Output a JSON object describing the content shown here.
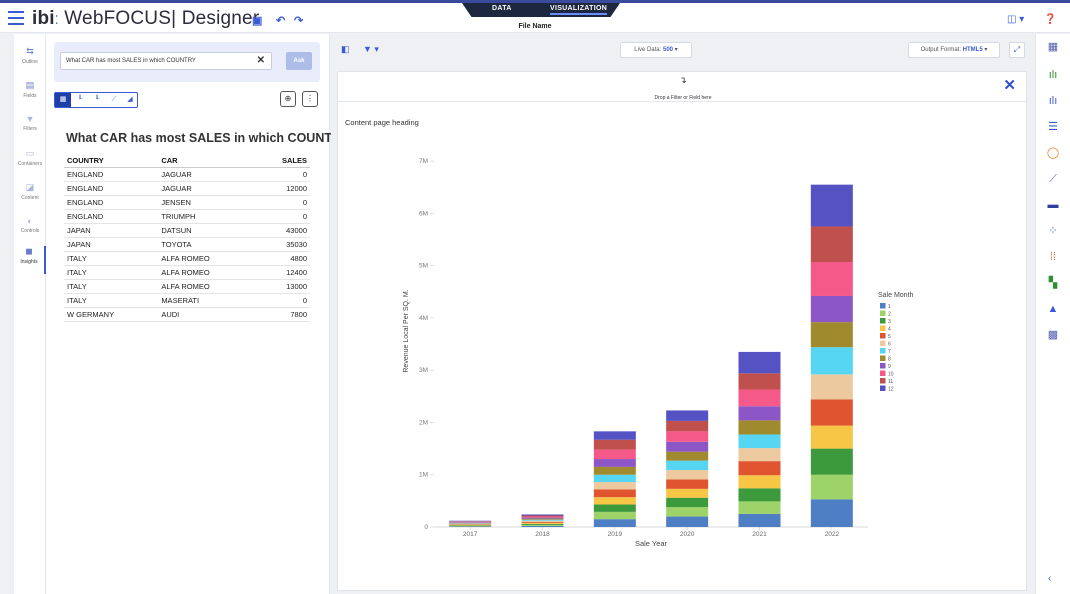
{
  "header": {
    "app_title": "WebFOCUS",
    "app_subtitle": "| Designer",
    "brand_mark": "ibi",
    "tabs": [
      "DATA",
      "VISUALIZATION"
    ],
    "active_tab": "VISUALIZATION",
    "file_name": "File Name"
  },
  "leftnav": {
    "items": [
      {
        "label": "Outline",
        "icon": "outline-icon"
      },
      {
        "label": "Fields",
        "icon": "fields-icon"
      },
      {
        "label": "Filters",
        "icon": "filter-icon"
      },
      {
        "label": "Containers",
        "icon": "containers-icon"
      },
      {
        "label": "Content",
        "icon": "content-icon"
      },
      {
        "label": "Controls",
        "icon": "controls-icon"
      },
      {
        "label": "Insights",
        "icon": "insights-icon"
      }
    ],
    "active": "Insights"
  },
  "ask": {
    "query": "What CAR has most SALES in which COUNTRY",
    "button": "Ask"
  },
  "report": {
    "title": "What CAR has most SALES in which COUNTRY",
    "columns": [
      "COUNTRY",
      "CAR",
      "SALES"
    ],
    "rows": [
      [
        "ENGLAND",
        "JAGUAR",
        "0"
      ],
      [
        "ENGLAND",
        "JAGUAR",
        "12000"
      ],
      [
        "ENGLAND",
        "JENSEN",
        "0"
      ],
      [
        "ENGLAND",
        "TRIUMPH",
        "0"
      ],
      [
        "JAPAN",
        "DATSUN",
        "43000"
      ],
      [
        "JAPAN",
        "TOYOTA",
        "35030"
      ],
      [
        "ITALY",
        "ALFA ROMEO",
        "4800"
      ],
      [
        "ITALY",
        "ALFA ROMEO",
        "12400"
      ],
      [
        "ITALY",
        "ALFA ROMEO",
        "13000"
      ],
      [
        "ITALY",
        "MASERATI",
        "0"
      ],
      [
        "W GERMANY",
        "AUDI",
        "7800"
      ]
    ]
  },
  "canvas_toolbar": {
    "live_data_label": "Live Data:",
    "live_data_value": "500",
    "output_format_label": "Output Format:",
    "output_format_value": "HTML5"
  },
  "page": {
    "drop_hint": "Drop a Filter or Field here",
    "heading": "Content page heading"
  },
  "chart_data": {
    "type": "bar",
    "stacked": true,
    "xlabel": "Sale Year",
    "ylabel": "Revenue Local Per SQ. M.",
    "ylim": [
      0,
      7500000
    ],
    "yticks": [
      "0",
      "1M",
      "2M",
      "3M",
      "4M",
      "5M",
      "6M",
      "7M"
    ],
    "categories": [
      "2017",
      "2018",
      "2019",
      "2020",
      "2021",
      "2022"
    ],
    "legend_title": "Sale Month",
    "legend_position": "right",
    "series": [
      {
        "name": "1",
        "color": "#4e7fc4",
        "values": [
          10000,
          20000,
          150000,
          200000,
          250000,
          530000
        ]
      },
      {
        "name": "2",
        "color": "#9ed36a",
        "values": [
          10000,
          20000,
          140000,
          180000,
          240000,
          470000
        ]
      },
      {
        "name": "3",
        "color": "#3d9a3c",
        "values": [
          10000,
          20000,
          140000,
          180000,
          250000,
          500000
        ]
      },
      {
        "name": "4",
        "color": "#f7c644",
        "values": [
          10000,
          20000,
          140000,
          170000,
          250000,
          440000
        ]
      },
      {
        "name": "5",
        "color": "#e05530",
        "values": [
          10000,
          20000,
          150000,
          180000,
          270000,
          500000
        ]
      },
      {
        "name": "6",
        "color": "#ecc99e",
        "values": [
          10000,
          20000,
          140000,
          180000,
          250000,
          480000
        ]
      },
      {
        "name": "7",
        "color": "#56d6f2",
        "values": [
          10000,
          20000,
          140000,
          180000,
          260000,
          520000
        ]
      },
      {
        "name": "8",
        "color": "#a08a2e",
        "values": [
          10000,
          20000,
          150000,
          170000,
          270000,
          480000
        ]
      },
      {
        "name": "9",
        "color": "#8c56c6",
        "values": [
          10000,
          20000,
          150000,
          190000,
          270000,
          500000
        ]
      },
      {
        "name": "10",
        "color": "#f4598a",
        "values": [
          10000,
          20000,
          180000,
          200000,
          320000,
          650000
        ]
      },
      {
        "name": "11",
        "color": "#c0504e",
        "values": [
          10000,
          20000,
          190000,
          200000,
          310000,
          680000
        ]
      },
      {
        "name": "12",
        "color": "#5552c4",
        "values": [
          10000,
          20000,
          160000,
          200000,
          410000,
          800000
        ]
      }
    ]
  }
}
